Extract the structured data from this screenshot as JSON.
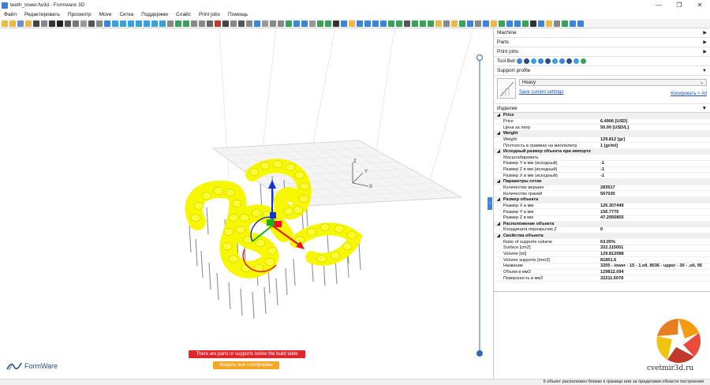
{
  "window": {
    "title": "teeth_tower.fw3d - Formware 3D",
    "min": "—",
    "max": "❐",
    "close": "✕"
  },
  "menu": [
    "Файл",
    "Редактировать",
    "Просмотр",
    "Move",
    "Сетка",
    "Поддержки",
    "Слайс",
    "Print jobs",
    "Помощь"
  ],
  "colors": {
    "accent": "#3d86d6",
    "model": "#f7f700",
    "support": "#9a9a9a",
    "warning": "#e3262b",
    "orange": "#f5a623"
  },
  "viewport": {
    "warning_label": "There are parts or supports below the build table",
    "orange_label": "Модель вне платформы",
    "logo_text": "FormWare",
    "axis_labels": {
      "x": "X",
      "y": "Y",
      "z": "Z"
    }
  },
  "panel": {
    "machine": "Machine",
    "parts": "Parts",
    "print_jobs": "Print jobs",
    "tool_belt": "Tool Belt",
    "support_profile": "Support profile",
    "profile_value": "Heavy",
    "save_settings": "Save current settings",
    "copy_link": "Копировать + All",
    "izdelie": "Изделие"
  },
  "properties": [
    {
      "group": "Price"
    },
    {
      "k": "Price",
      "v": "6.4906 [USD]"
    },
    {
      "k": "Цена за литр",
      "v": "50.00 [USD/L]"
    },
    {
      "group": "Weight"
    },
    {
      "k": "Weight",
      "v": "129.812 [gr]"
    },
    {
      "k": "Плотность в граммах на миллилитр",
      "v": "1 [gr/ml]"
    },
    {
      "group": "Исходный размер объекта при импорте"
    },
    {
      "k": "Масштабировать",
      "v": ""
    },
    {
      "k": "Размер Y в мм (исходный)",
      "v": "-1"
    },
    {
      "k": "Размер Z в мм (исходный)",
      "v": "-1"
    },
    {
      "k": "Размер X в мм (исходный)",
      "v": "-1"
    },
    {
      "group": "Параметры сетки"
    },
    {
      "k": "Количество вершин",
      "v": "283517"
    },
    {
      "k": "Количество граней",
      "v": "567030"
    },
    {
      "group": "Размер объекта"
    },
    {
      "k": "Размер X в мм",
      "v": "126.307449"
    },
    {
      "k": "Размер Y в мм",
      "v": "156.7775"
    },
    {
      "k": "Размер Z в мм",
      "v": "47.2055855"
    },
    {
      "group": "Расположение объекта"
    },
    {
      "k": "Координата перекрытия Z",
      "v": "0"
    },
    {
      "group": "Свойства объекта"
    },
    {
      "k": "Ratio of supports volume",
      "v": "63.05%"
    },
    {
      "k": "Surface [cm2]",
      "v": "322.115051"
    },
    {
      "k": "Volume [ml]",
      "v": "129.812088"
    },
    {
      "k": "Volume supports [mm3]",
      "v": "81851.6"
    },
    {
      "k": "Название",
      "v": "3205 - lower - 15 - 1.stl, 8036 - upper - 30 - .stl, 95"
    },
    {
      "k": "Объем в мм3",
      "v": "129812.094"
    },
    {
      "k": "Поверхность в мм2",
      "v": "32211.5078"
    }
  ],
  "status": {
    "text": "6 объект расположен близко к границе или за пределами области построения"
  },
  "watermark": {
    "text": "cvetmir3d.ru"
  }
}
